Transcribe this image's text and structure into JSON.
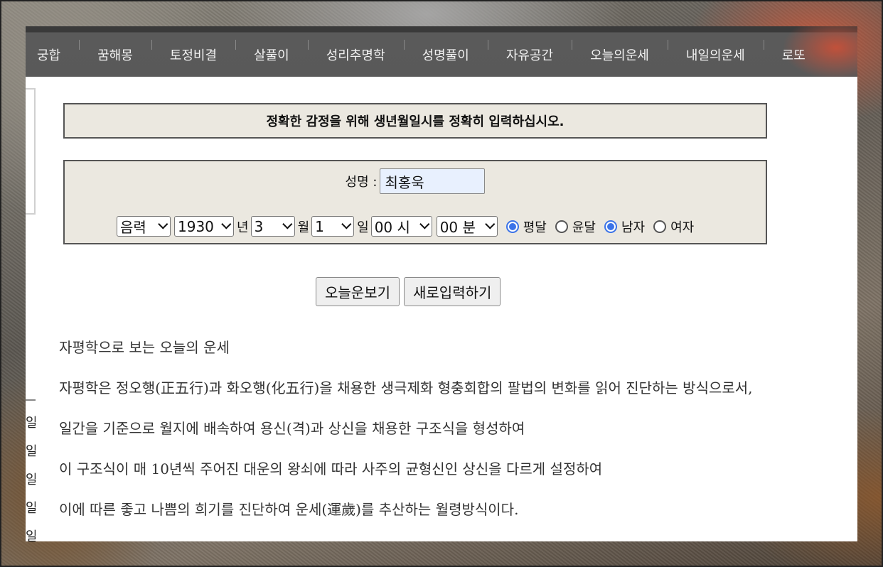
{
  "nav": {
    "items": [
      "궁합",
      "꿈해몽",
      "토정비결",
      "살풀이",
      "성리추명학",
      "성명풀이",
      "자유공간",
      "오늘의운세",
      "내일의운세",
      "로또"
    ]
  },
  "notice": "정확한 감정을 위해 생년월일시를 정확히 입력하십시오.",
  "form": {
    "name_label": "성명 :",
    "name_value": "최홍욱",
    "calendar": "음력",
    "year": "1930",
    "year_unit": "년",
    "month": "3",
    "month_unit": "월",
    "day": "1",
    "day_unit": "일",
    "hour": "00 시",
    "minute": "00 분",
    "radios": [
      {
        "label": "평달",
        "checked": true
      },
      {
        "label": "윤달",
        "checked": false
      },
      {
        "label": "남자",
        "checked": true
      },
      {
        "label": "여자",
        "checked": false
      }
    ]
  },
  "buttons": {
    "view_today": "오늘운보기",
    "reset": "새로입력하기"
  },
  "left_fragment_chars": [
    "일",
    "일",
    "일",
    "일",
    "일"
  ],
  "content": {
    "paragraphs": [
      "자평학으로 보는 오늘의 운세",
      "자평학은 정오행(正五行)과 화오행(化五行)을 채용한 생극제화 형충회합의 팔법의 변화를 읽어 진단하는 방식으로서,",
      "일간을 기준으로 월지에 배속하여 용신(격)과 상신을 채용한 구조식을 형성하여",
      "이 구조식이 매 10년씩 주어진 대운의 왕쇠에 따라 사주의 균형신인 상신을 다르게 설정하여",
      "이에 따른 좋고 나쁨의 희기를 진단하여 운세(運歲)를 추산하는 월령방식이다."
    ]
  }
}
